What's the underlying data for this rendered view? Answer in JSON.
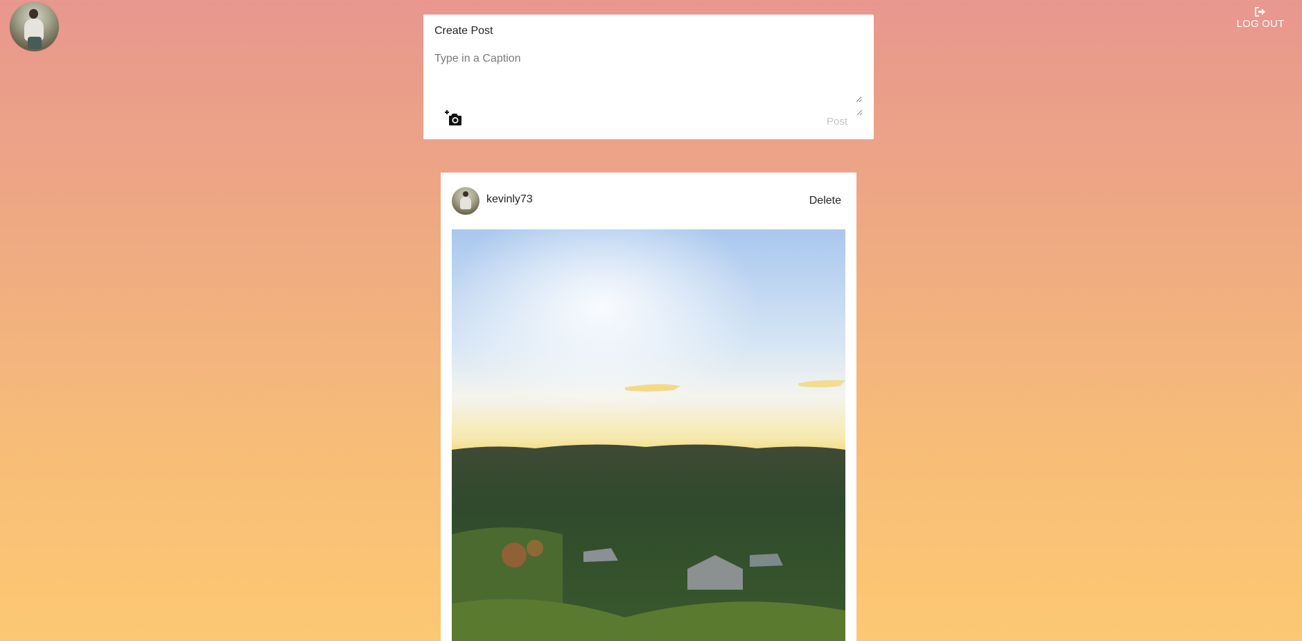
{
  "header": {
    "logout_label": "LOG OUT"
  },
  "create_post": {
    "title": "Create Post",
    "caption_placeholder": "Type in a Caption",
    "caption_value": "",
    "post_label": "Post"
  },
  "feed": {
    "posts": [
      {
        "username": "kevinly73",
        "delete_label": "Delete"
      }
    ]
  },
  "colors": {
    "bg_top": "#e8978e",
    "bg_bottom": "#fdc873",
    "card": "#ffffff",
    "post_disabled": "#c4c4c4"
  },
  "icons": {
    "logout": "logout-icon",
    "camera": "add-photo-icon"
  }
}
